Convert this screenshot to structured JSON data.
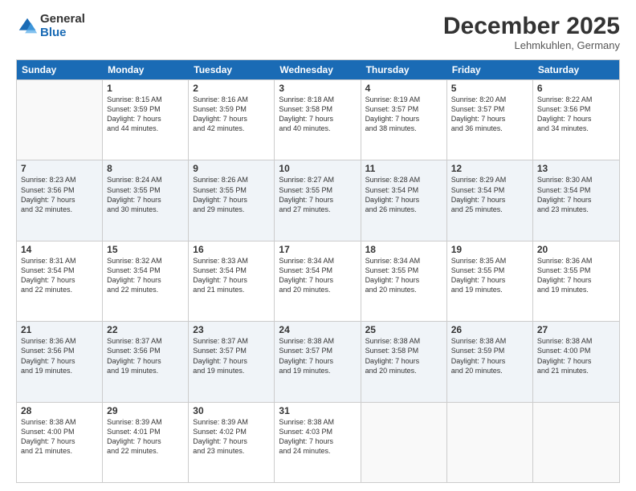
{
  "logo": {
    "general": "General",
    "blue": "Blue"
  },
  "title": "December 2025",
  "subtitle": "Lehmkuhlen, Germany",
  "header_days": [
    "Sunday",
    "Monday",
    "Tuesday",
    "Wednesday",
    "Thursday",
    "Friday",
    "Saturday"
  ],
  "rows": [
    [
      {
        "day": "",
        "lines": []
      },
      {
        "day": "1",
        "lines": [
          "Sunrise: 8:15 AM",
          "Sunset: 3:59 PM",
          "Daylight: 7 hours",
          "and 44 minutes."
        ]
      },
      {
        "day": "2",
        "lines": [
          "Sunrise: 8:16 AM",
          "Sunset: 3:59 PM",
          "Daylight: 7 hours",
          "and 42 minutes."
        ]
      },
      {
        "day": "3",
        "lines": [
          "Sunrise: 8:18 AM",
          "Sunset: 3:58 PM",
          "Daylight: 7 hours",
          "and 40 minutes."
        ]
      },
      {
        "day": "4",
        "lines": [
          "Sunrise: 8:19 AM",
          "Sunset: 3:57 PM",
          "Daylight: 7 hours",
          "and 38 minutes."
        ]
      },
      {
        "day": "5",
        "lines": [
          "Sunrise: 8:20 AM",
          "Sunset: 3:57 PM",
          "Daylight: 7 hours",
          "and 36 minutes."
        ]
      },
      {
        "day": "6",
        "lines": [
          "Sunrise: 8:22 AM",
          "Sunset: 3:56 PM",
          "Daylight: 7 hours",
          "and 34 minutes."
        ]
      }
    ],
    [
      {
        "day": "7",
        "lines": [
          "Sunrise: 8:23 AM",
          "Sunset: 3:56 PM",
          "Daylight: 7 hours",
          "and 32 minutes."
        ]
      },
      {
        "day": "8",
        "lines": [
          "Sunrise: 8:24 AM",
          "Sunset: 3:55 PM",
          "Daylight: 7 hours",
          "and 30 minutes."
        ]
      },
      {
        "day": "9",
        "lines": [
          "Sunrise: 8:26 AM",
          "Sunset: 3:55 PM",
          "Daylight: 7 hours",
          "and 29 minutes."
        ]
      },
      {
        "day": "10",
        "lines": [
          "Sunrise: 8:27 AM",
          "Sunset: 3:55 PM",
          "Daylight: 7 hours",
          "and 27 minutes."
        ]
      },
      {
        "day": "11",
        "lines": [
          "Sunrise: 8:28 AM",
          "Sunset: 3:54 PM",
          "Daylight: 7 hours",
          "and 26 minutes."
        ]
      },
      {
        "day": "12",
        "lines": [
          "Sunrise: 8:29 AM",
          "Sunset: 3:54 PM",
          "Daylight: 7 hours",
          "and 25 minutes."
        ]
      },
      {
        "day": "13",
        "lines": [
          "Sunrise: 8:30 AM",
          "Sunset: 3:54 PM",
          "Daylight: 7 hours",
          "and 23 minutes."
        ]
      }
    ],
    [
      {
        "day": "14",
        "lines": [
          "Sunrise: 8:31 AM",
          "Sunset: 3:54 PM",
          "Daylight: 7 hours",
          "and 22 minutes."
        ]
      },
      {
        "day": "15",
        "lines": [
          "Sunrise: 8:32 AM",
          "Sunset: 3:54 PM",
          "Daylight: 7 hours",
          "and 22 minutes."
        ]
      },
      {
        "day": "16",
        "lines": [
          "Sunrise: 8:33 AM",
          "Sunset: 3:54 PM",
          "Daylight: 7 hours",
          "and 21 minutes."
        ]
      },
      {
        "day": "17",
        "lines": [
          "Sunrise: 8:34 AM",
          "Sunset: 3:54 PM",
          "Daylight: 7 hours",
          "and 20 minutes."
        ]
      },
      {
        "day": "18",
        "lines": [
          "Sunrise: 8:34 AM",
          "Sunset: 3:55 PM",
          "Daylight: 7 hours",
          "and 20 minutes."
        ]
      },
      {
        "day": "19",
        "lines": [
          "Sunrise: 8:35 AM",
          "Sunset: 3:55 PM",
          "Daylight: 7 hours",
          "and 19 minutes."
        ]
      },
      {
        "day": "20",
        "lines": [
          "Sunrise: 8:36 AM",
          "Sunset: 3:55 PM",
          "Daylight: 7 hours",
          "and 19 minutes."
        ]
      }
    ],
    [
      {
        "day": "21",
        "lines": [
          "Sunrise: 8:36 AM",
          "Sunset: 3:56 PM",
          "Daylight: 7 hours",
          "and 19 minutes."
        ]
      },
      {
        "day": "22",
        "lines": [
          "Sunrise: 8:37 AM",
          "Sunset: 3:56 PM",
          "Daylight: 7 hours",
          "and 19 minutes."
        ]
      },
      {
        "day": "23",
        "lines": [
          "Sunrise: 8:37 AM",
          "Sunset: 3:57 PM",
          "Daylight: 7 hours",
          "and 19 minutes."
        ]
      },
      {
        "day": "24",
        "lines": [
          "Sunrise: 8:38 AM",
          "Sunset: 3:57 PM",
          "Daylight: 7 hours",
          "and 19 minutes."
        ]
      },
      {
        "day": "25",
        "lines": [
          "Sunrise: 8:38 AM",
          "Sunset: 3:58 PM",
          "Daylight: 7 hours",
          "and 20 minutes."
        ]
      },
      {
        "day": "26",
        "lines": [
          "Sunrise: 8:38 AM",
          "Sunset: 3:59 PM",
          "Daylight: 7 hours",
          "and 20 minutes."
        ]
      },
      {
        "day": "27",
        "lines": [
          "Sunrise: 8:38 AM",
          "Sunset: 4:00 PM",
          "Daylight: 7 hours",
          "and 21 minutes."
        ]
      }
    ],
    [
      {
        "day": "28",
        "lines": [
          "Sunrise: 8:38 AM",
          "Sunset: 4:00 PM",
          "Daylight: 7 hours",
          "and 21 minutes."
        ]
      },
      {
        "day": "29",
        "lines": [
          "Sunrise: 8:39 AM",
          "Sunset: 4:01 PM",
          "Daylight: 7 hours",
          "and 22 minutes."
        ]
      },
      {
        "day": "30",
        "lines": [
          "Sunrise: 8:39 AM",
          "Sunset: 4:02 PM",
          "Daylight: 7 hours",
          "and 23 minutes."
        ]
      },
      {
        "day": "31",
        "lines": [
          "Sunrise: 8:38 AM",
          "Sunset: 4:03 PM",
          "Daylight: 7 hours",
          "and 24 minutes."
        ]
      },
      {
        "day": "",
        "lines": []
      },
      {
        "day": "",
        "lines": []
      },
      {
        "day": "",
        "lines": []
      }
    ]
  ]
}
